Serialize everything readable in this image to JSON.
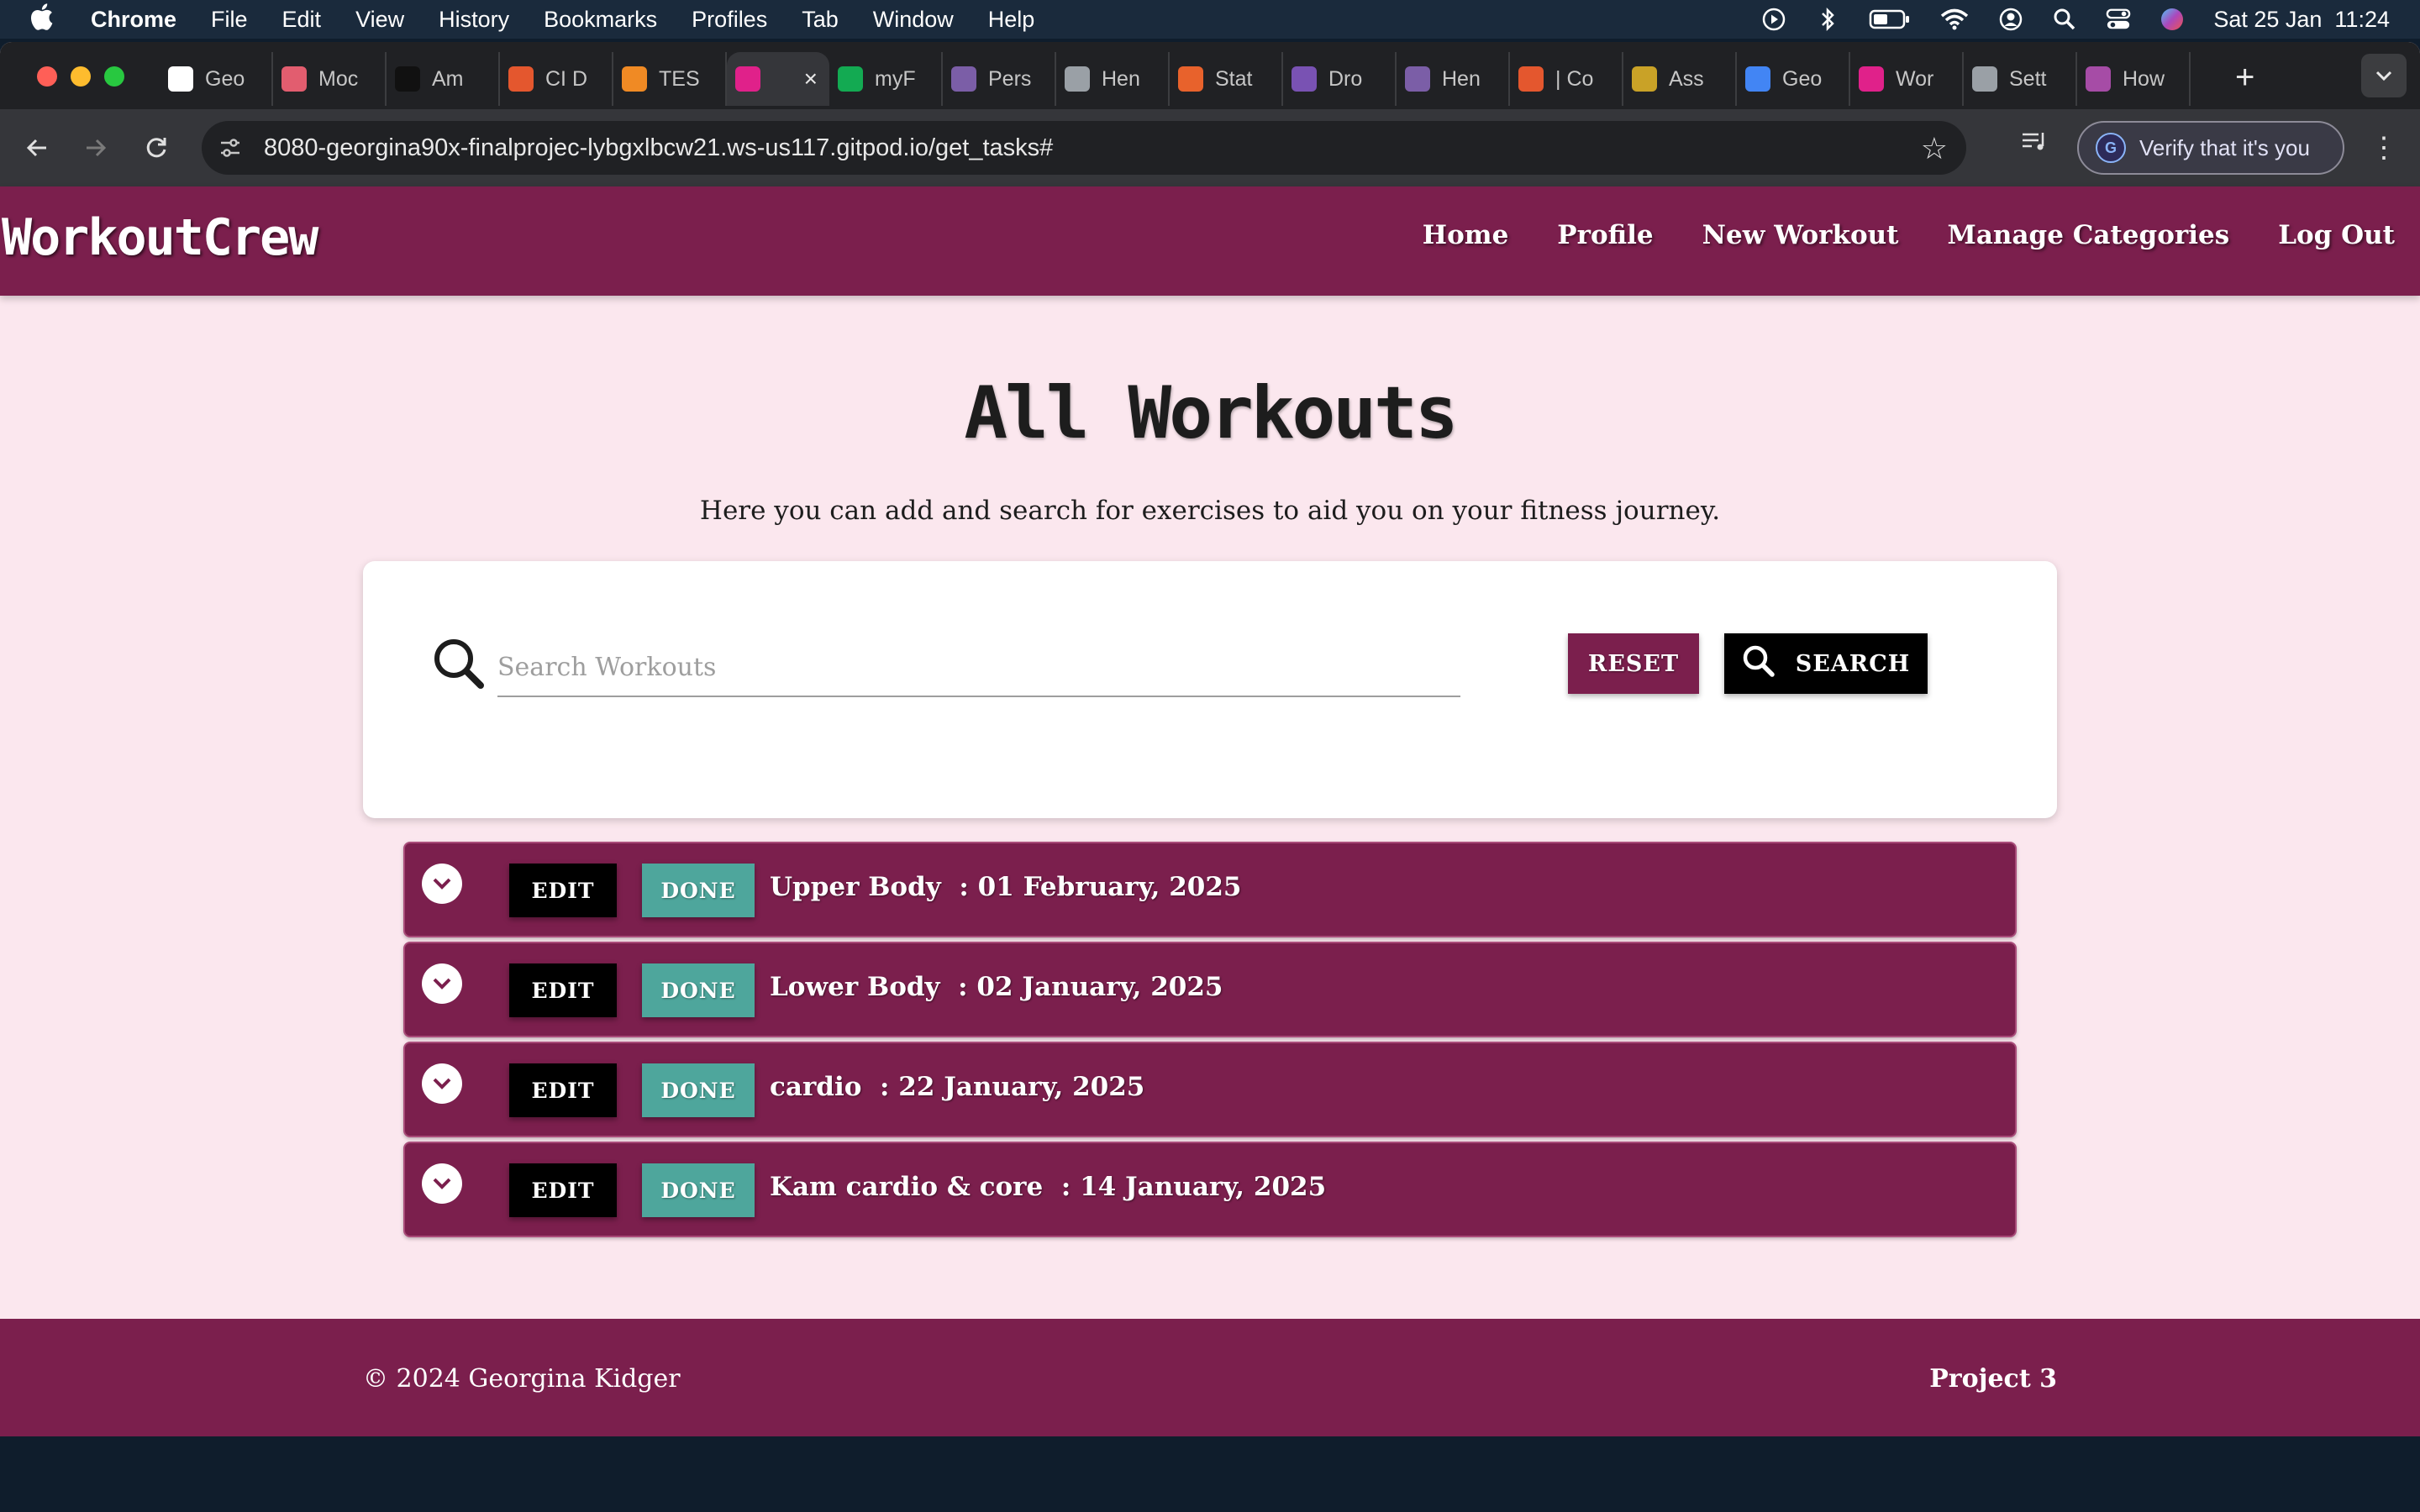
{
  "menubar": {
    "app_name": "Chrome",
    "items": [
      "File",
      "Edit",
      "View",
      "History",
      "Bookmarks",
      "Profiles",
      "Tab",
      "Window",
      "Help"
    ],
    "clock": "Sat 25 Jan  11:24"
  },
  "browser": {
    "tabs": [
      {
        "label": "Geo",
        "icon": "github-icon",
        "color": "#ffffff"
      },
      {
        "label": "Moc",
        "icon": "mocha-icon",
        "color": "#e25d6f"
      },
      {
        "label": "Am",
        "icon": "u-icon",
        "color": "#111111"
      },
      {
        "label": "CI D",
        "icon": "ring-icon",
        "color": "#e4572e"
      },
      {
        "label": "TES",
        "icon": "g-icon",
        "color": "#f08a24"
      },
      {
        "label": "",
        "icon": "dumbbell-icon",
        "color": "#e0218a",
        "active": true
      },
      {
        "label": "myF",
        "icon": "leaf-icon",
        "color": "#13aa52"
      },
      {
        "label": "Pers",
        "icon": "k-icon",
        "color": "#7b5ea7"
      },
      {
        "label": "Hen",
        "icon": "globe-icon",
        "color": "#9aa0a6"
      },
      {
        "label": "Stat",
        "icon": "air-icon",
        "color": "#e8622c"
      },
      {
        "label": "Dro",
        "icon": "bootstrap-icon",
        "color": "#7952b3"
      },
      {
        "label": "Hen",
        "icon": "k-icon",
        "color": "#7b5ea7"
      },
      {
        "label": "| Co",
        "icon": "ring-icon",
        "color": "#e4572e"
      },
      {
        "label": "Ass",
        "icon": "image-icon",
        "color": "#c9a227"
      },
      {
        "label": "Geo",
        "icon": "docs-icon",
        "color": "#4285f4"
      },
      {
        "label": "Wor",
        "icon": "dumbbell-icon",
        "color": "#e0218a"
      },
      {
        "label": "Sett",
        "icon": "gear-icon",
        "color": "#9aa0a6"
      },
      {
        "label": "How",
        "icon": "hex-icon",
        "color": "#a64ca6"
      }
    ],
    "url": "8080-georgina90x-finalprojec-lybgxlbcw21.ws-us117.gitpod.io/get_tasks#",
    "verify_label": "Verify that it's you",
    "profile_initial": "G"
  },
  "site": {
    "brand": "WorkoutCrew",
    "nav": [
      "Home",
      "Profile",
      "New Workout",
      "Manage Categories",
      "Log Out"
    ],
    "colors": {
      "primary": "#7b1f4d",
      "done": "#4ea69c",
      "background": "#fbe7ee"
    }
  },
  "main": {
    "title": "All Workouts",
    "subtitle": "Here you can add and search for exercises to aid you on your fitness journey.",
    "search": {
      "placeholder": "Search Workouts",
      "value": "",
      "reset_label": "RESET",
      "search_label": "SEARCH"
    },
    "workouts": [
      {
        "name": "Upper Body",
        "date": "01 February, 2025",
        "edit_label": "EDIT",
        "done_label": "DONE"
      },
      {
        "name": "Lower Body",
        "date": "02 January, 2025",
        "edit_label": "EDIT",
        "done_label": "DONE"
      },
      {
        "name": "cardio",
        "date": "22 January, 2025",
        "edit_label": "EDIT",
        "done_label": "DONE"
      },
      {
        "name": "Kam cardio & core",
        "date": "14 January, 2025",
        "edit_label": "EDIT",
        "done_label": "DONE"
      }
    ]
  },
  "footer": {
    "copyright": "© 2024 Georgina Kidger",
    "project": "Project 3"
  }
}
